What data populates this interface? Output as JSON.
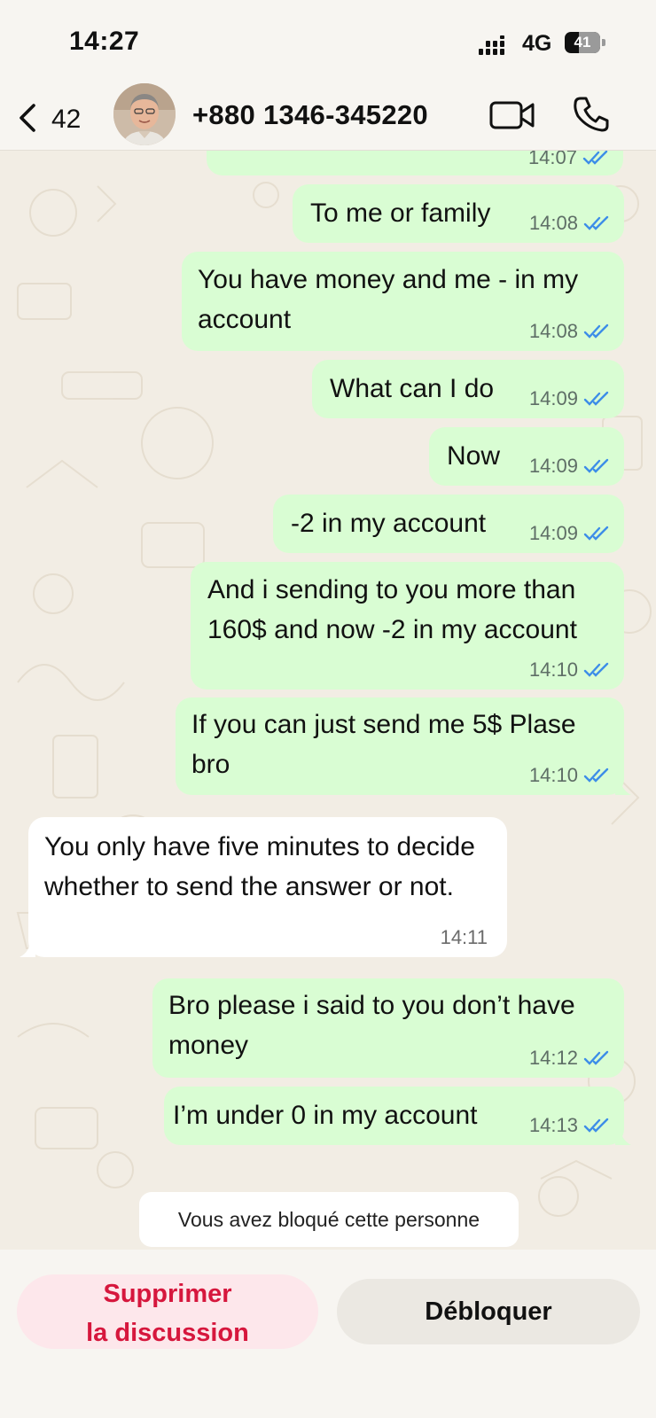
{
  "status_bar": {
    "time": "14:27",
    "network": "4G",
    "battery": "41",
    "battery_level": 0.41
  },
  "header": {
    "back_count": "42",
    "contact_name": "+880 1346-345220",
    "icons": [
      "chevron-left-icon",
      "video-call-icon",
      "phone-call-icon"
    ]
  },
  "messages": [
    {
      "direction": "out",
      "text": "",
      "time": "14:07",
      "status": "read"
    },
    {
      "direction": "out",
      "text": "To me or family",
      "time": "14:08",
      "status": "read"
    },
    {
      "direction": "out",
      "text": "You have money and me - in my account",
      "time": "14:08",
      "status": "read"
    },
    {
      "direction": "out",
      "text": "What can I do",
      "time": "14:09",
      "status": "read"
    },
    {
      "direction": "out",
      "text": "Now",
      "time": "14:09",
      "status": "read"
    },
    {
      "direction": "out",
      "text": "-2 in my account",
      "time": "14:09",
      "status": "read"
    },
    {
      "direction": "out",
      "text": "And i sending to you more than 160$ and now -2 in my account",
      "time": "14:10",
      "status": "read"
    },
    {
      "direction": "out",
      "text": "If you can just send me 5$ Plase bro",
      "time": "14:10",
      "status": "read"
    },
    {
      "direction": "in",
      "text": "You only have five minutes to decide whether to send the answer or not.",
      "time": "14:11"
    },
    {
      "direction": "out",
      "text": "Bro please i said to you don’t have money",
      "time": "14:12",
      "status": "read"
    },
    {
      "direction": "out",
      "text": "I’m under 0 in my account",
      "time": "14:13",
      "status": "read"
    }
  ],
  "system_notice": "Vous avez bloqué cette personne",
  "actions": {
    "delete_line1": "Supprimer",
    "delete_line2": "la discussion",
    "unblock": "Débloquer"
  },
  "colors": {
    "outgoing_bubble": "#d9fdd3",
    "incoming_bubble": "#ffffff",
    "read_ticks": "#3d8de8",
    "delete_text": "#d6173d",
    "wallpaper": "#f2ede4"
  }
}
